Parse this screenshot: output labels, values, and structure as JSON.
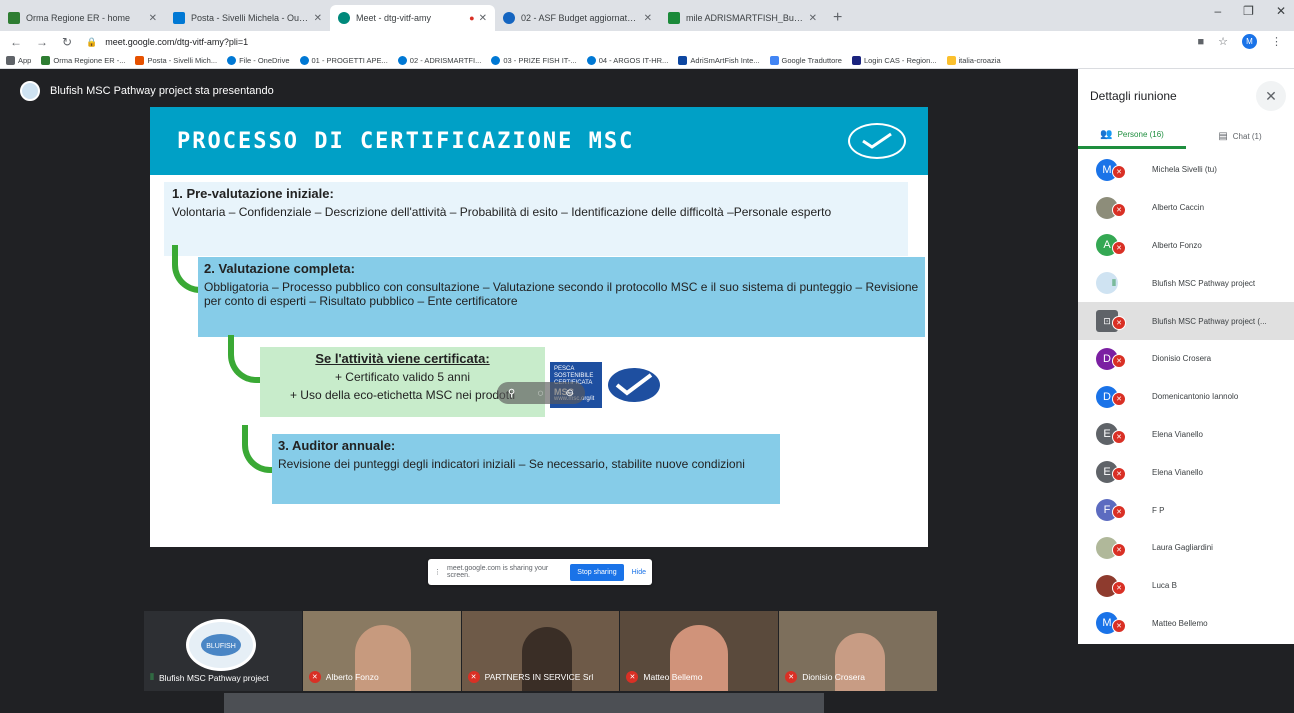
{
  "browser": {
    "tabs": [
      {
        "title": "Orma Regione ER - home",
        "color": "#2e7d32"
      },
      {
        "title": "Posta - Sivelli Michela - Outlook",
        "color": "#0078d4"
      },
      {
        "title": "Meet - dtg-vitf-amy",
        "color": "#00897b"
      },
      {
        "title": "02 - ASF Budget aggiornato - D",
        "color": "#1565c0"
      },
      {
        "title": "mile ADRISMARTFISH_Budget_2",
        "color": "#1b8a3a"
      }
    ],
    "url": "meet.google.com/dtg-vitf-amy?pli=1",
    "profile_initial": "M",
    "bookmarks": [
      {
        "label": "App",
        "color": "#5f6368"
      },
      {
        "label": "Orma Regione ER -...",
        "color": "#2e7d32"
      },
      {
        "label": "Posta - Sivelli Mich...",
        "color": "#e65100"
      },
      {
        "label": "File - OneDrive",
        "color": "#0078d4"
      },
      {
        "label": "01 - PROGETTI APE...",
        "color": "#0078d4"
      },
      {
        "label": "02 - ADRISMARTFI...",
        "color": "#0078d4"
      },
      {
        "label": "03 - PRIZE FISH IT-...",
        "color": "#0078d4"
      },
      {
        "label": "04 - ARGOS IT-HR...",
        "color": "#0078d4"
      },
      {
        "label": "AdriSmArtFish Inte...",
        "color": "#0d47a1"
      },
      {
        "label": "Google Traduttore",
        "color": "#4285f4"
      },
      {
        "label": "Login CAS - Region...",
        "color": "#1a237e"
      },
      {
        "label": "italia-croazia",
        "color": "#fbc02d"
      }
    ]
  },
  "meet": {
    "presenter_text": "Blufish MSC Pathway project sta presentando",
    "slide": {
      "title": "PROCESSO DI CERTIFICAZIONE MSC",
      "step1_heading": "1. Pre-valutazione iniziale:",
      "step1_text": "Volontaria – Confidenziale – Descrizione dell'attività – Probabilità di esito – Identificazione delle difficoltà –Personale esperto",
      "step2_heading": "2. Valutazione completa:",
      "step2_text": "Obbligatoria – Processo pubblico con consultazione – Valutazione secondo il protocollo MSC e il suo sistema di punteggio – Revisione per conto di esperti – Risultato pubblico – Ente certificatore",
      "cert_heading": "Se l'attività viene certificata:",
      "cert_line1": "+ Certificato valido 5 anni",
      "cert_line2": "+ Uso della eco-etichetta MSC nei prodotti",
      "eco_label_text": "PESCA SOSTENIBILE CERTIFICATA",
      "eco_label_brand": "MSC",
      "eco_label_url": "www.msc.org/it",
      "step3_heading": "3. Auditor annuale:",
      "step3_text": "Revisione dei punteggi degli indicatori iniziali – Se necessario, stabilite nuove condizioni"
    },
    "share_bar": {
      "text": "meet.google.com is sharing your screen.",
      "stop_label": "Stop sharing",
      "hide_label": "Hide"
    },
    "tiles": [
      {
        "name": "Blufish MSC Pathway project",
        "bg": "#2d2f33",
        "speaking": true
      },
      {
        "name": "Alberto Fonzo",
        "bg": "#8a7a62",
        "speaking": false
      },
      {
        "name": "PARTNERS IN SERVICE Srl",
        "bg": "#6e5a48",
        "speaking": false
      },
      {
        "name": "Matteo Bellemo",
        "bg": "#5a4a3c",
        "speaking": false
      },
      {
        "name": "Dionisio Crosera",
        "bg": "#7d6f5c",
        "speaking": false
      }
    ]
  },
  "panel": {
    "title": "Dettagli riunione",
    "tab_people": "Persone (16)",
    "tab_chat": "Chat (1)",
    "people": [
      {
        "name": "Michela Sivelli (tu)",
        "initial": "M",
        "color": "#1a73e8",
        "muted": true,
        "photo": false
      },
      {
        "name": "Alberto Caccin",
        "initial": "",
        "color": "#8d8d7a",
        "muted": true,
        "photo": true
      },
      {
        "name": "Alberto Fonzo",
        "initial": "A",
        "color": "#34a853",
        "muted": true,
        "photo": false
      },
      {
        "name": "Blufish MSC Pathway project",
        "initial": "",
        "color": "#cfe3f2",
        "muted": false,
        "photo": true
      },
      {
        "name": "Blufish MSC Pathway project (...",
        "initial": "",
        "color": "#5f6368",
        "muted": true,
        "photo": true,
        "highlight": true
      },
      {
        "name": "Dionisio Crosera",
        "initial": "D",
        "color": "#7b1fa2",
        "muted": true,
        "photo": false
      },
      {
        "name": "Domenicantonio Iannolo",
        "initial": "D",
        "color": "#1a73e8",
        "muted": true,
        "photo": false
      },
      {
        "name": "Elena Vianello",
        "initial": "E",
        "color": "#5f6368",
        "muted": true,
        "photo": false
      },
      {
        "name": "Elena Vianello",
        "initial": "E",
        "color": "#5f6368",
        "muted": true,
        "photo": false
      },
      {
        "name": "F P",
        "initial": "F",
        "color": "#5c6bc0",
        "muted": true,
        "photo": false
      },
      {
        "name": "Laura Gagliardini",
        "initial": "",
        "color": "#b0b89a",
        "muted": true,
        "photo": true
      },
      {
        "name": "Luca B",
        "initial": "",
        "color": "#8e3b2e",
        "muted": true,
        "photo": true
      },
      {
        "name": "Matteo Bellemo",
        "initial": "M",
        "color": "#1a73e8",
        "muted": true,
        "photo": false
      }
    ]
  }
}
